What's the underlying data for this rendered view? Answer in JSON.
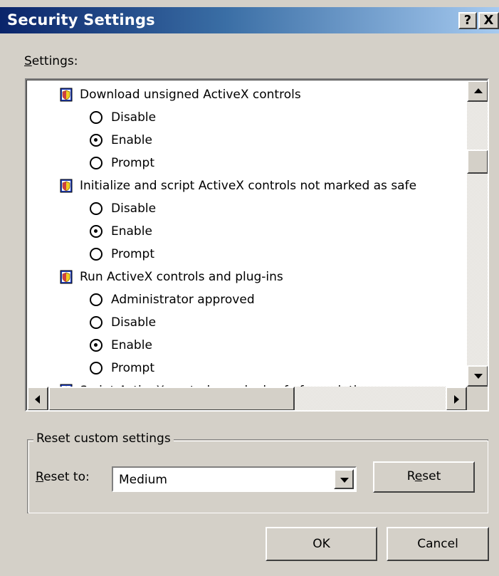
{
  "window": {
    "title": "Security Settings",
    "help_button": "?",
    "close_button": "X"
  },
  "settings_label": "Settings:",
  "settings_list": [
    {
      "kind": "category",
      "label": "Download unsigned ActiveX controls"
    },
    {
      "kind": "option",
      "label": "Disable",
      "selected": false
    },
    {
      "kind": "option",
      "label": "Enable",
      "selected": true
    },
    {
      "kind": "option",
      "label": "Prompt",
      "selected": false
    },
    {
      "kind": "category",
      "label": "Initialize and script ActiveX controls not marked as safe"
    },
    {
      "kind": "option",
      "label": "Disable",
      "selected": false
    },
    {
      "kind": "option",
      "label": "Enable",
      "selected": true
    },
    {
      "kind": "option",
      "label": "Prompt",
      "selected": false
    },
    {
      "kind": "category",
      "label": "Run ActiveX controls and plug-ins"
    },
    {
      "kind": "option",
      "label": "Administrator approved",
      "selected": false
    },
    {
      "kind": "option",
      "label": "Disable",
      "selected": false
    },
    {
      "kind": "option",
      "label": "Enable",
      "selected": true
    },
    {
      "kind": "option",
      "label": "Prompt",
      "selected": false
    },
    {
      "kind": "category",
      "label": "Script ActiveX controls marked safe for scripting"
    }
  ],
  "reset_group": {
    "legend": "Reset custom settings",
    "reset_to_label": "Reset to:",
    "reset_to_value": "Medium",
    "reset_button": "Reset"
  },
  "buttons": {
    "ok": "OK",
    "cancel": "Cancel"
  },
  "colors": {
    "dialog_face": "#d4d0c8",
    "title_start": "#0a246a",
    "title_end": "#a6caf0"
  },
  "icons": {
    "category": "security-zone-icon",
    "radio": "radio-button"
  }
}
